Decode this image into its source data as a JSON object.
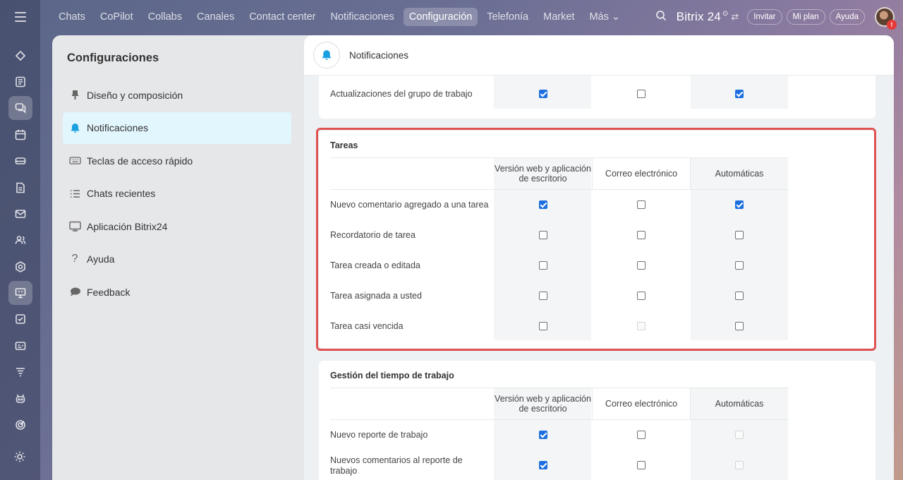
{
  "topnav": {
    "items": [
      "Chats",
      "CoPilot",
      "Collabs",
      "Canales",
      "Contact center",
      "Notificaciones",
      "Configuración",
      "Telefonía",
      "Market",
      "Más ⌄"
    ],
    "active_index": 6
  },
  "topright": {
    "brand": "Bitrix 24",
    "brand_sup": "⊙",
    "invite": "Invitar",
    "plan": "Mi plan",
    "help": "Ayuda",
    "alert": "!"
  },
  "settings": {
    "title": "Configuraciones",
    "menu": [
      {
        "label": "Diseño y composición",
        "icon": "brush-icon"
      },
      {
        "label": "Notificaciones",
        "icon": "bell-icon"
      },
      {
        "label": "Teclas de acceso rápido",
        "icon": "keyboard-icon"
      },
      {
        "label": "Chats recientes",
        "icon": "list-icon"
      },
      {
        "label": "Aplicación Bitrix24",
        "icon": "monitor-icon"
      },
      {
        "label": "Ayuda",
        "icon": "question-icon"
      },
      {
        "label": "Feedback",
        "icon": "speech-bubble-icon"
      }
    ],
    "active_index": 1
  },
  "content": {
    "header_title": "Notificaciones",
    "card_top": {
      "row_label": "Actualizaciones del grupo de trabajo",
      "values": [
        true,
        false,
        true
      ]
    },
    "tareas": {
      "title": "Tareas",
      "col_web": "Versión web y aplicación de escritorio",
      "col_email": "Correo electrónico",
      "col_auto": "Automáticas",
      "rows": [
        {
          "label": "Nuevo comentario agregado a una tarea",
          "values": [
            true,
            false,
            true
          ],
          "disabled": [
            false,
            false,
            false
          ]
        },
        {
          "label": "Recordatorio de tarea",
          "values": [
            false,
            false,
            false
          ],
          "disabled": [
            false,
            false,
            false
          ]
        },
        {
          "label": "Tarea creada o editada",
          "values": [
            false,
            false,
            false
          ],
          "disabled": [
            false,
            false,
            false
          ]
        },
        {
          "label": "Tarea asignada a usted",
          "values": [
            false,
            false,
            false
          ],
          "disabled": [
            false,
            false,
            false
          ]
        },
        {
          "label": "Tarea casi vencida",
          "values": [
            false,
            false,
            false
          ],
          "disabled": [
            false,
            true,
            false
          ]
        }
      ]
    },
    "tiempo": {
      "title": "Gestión del tiempo de trabajo",
      "col_web": "Versión web y aplicación de escritorio",
      "col_email": "Correo electrónico",
      "col_auto": "Automáticas",
      "rows": [
        {
          "label": "Nuevo reporte de trabajo",
          "values": [
            true,
            false,
            false
          ],
          "disabled": [
            false,
            false,
            true
          ]
        },
        {
          "label": "Nuevos comentarios al reporte de trabajo",
          "values": [
            true,
            false,
            false
          ],
          "disabled": [
            false,
            false,
            true
          ]
        }
      ]
    }
  },
  "colors": {
    "accent": "#1d6fe0",
    "highlight": "#e05252",
    "active_menu_bg": "#e2f6fe"
  }
}
